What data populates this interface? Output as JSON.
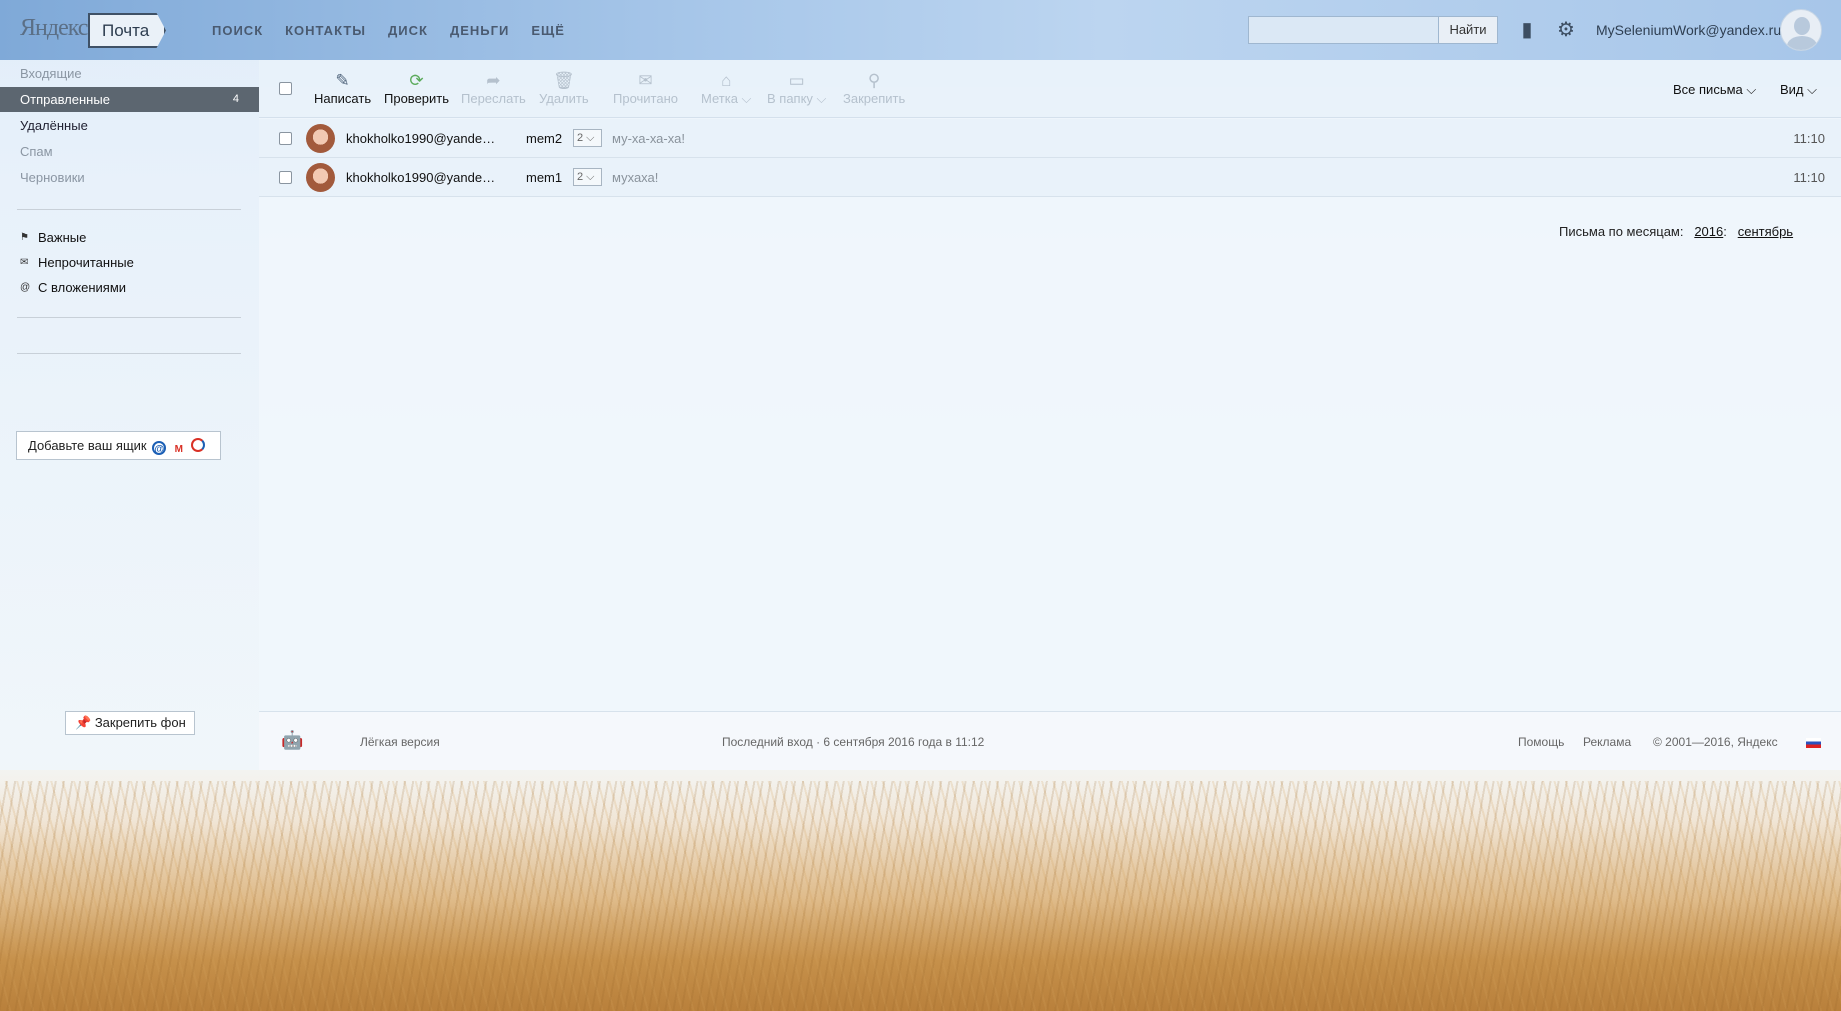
{
  "header": {
    "logo": "Яндекс",
    "service": "Почта",
    "nav": [
      "ПОИСК",
      "КОНТАКТЫ",
      "ДИСК",
      "ДЕНЬГИ",
      "ЕЩЁ"
    ],
    "search_placeholder": "",
    "search_button": "Найти",
    "user_email": "MySeleniumWork@yandex.ru"
  },
  "sidebar": {
    "folders": [
      {
        "label": "Входящие",
        "count": ""
      },
      {
        "label": "Отправленные",
        "count": "4"
      },
      {
        "label": "Удалённые",
        "count": ""
      },
      {
        "label": "Спам",
        "count": ""
      },
      {
        "label": "Черновики",
        "count": ""
      }
    ],
    "labels": [
      "Важные",
      "Непрочитанные",
      "С вложениями"
    ],
    "add_mailbox": "Добавьте ваш ящик",
    "pin_background": "Закрепить фон"
  },
  "toolbar": {
    "compose": "Написать",
    "check": "Проверить",
    "forward": "Переслать",
    "delete": "Удалить",
    "read": "Прочитано",
    "label": "Метка",
    "to_folder": "В папку",
    "pin": "Закрепить",
    "all_letters": "Все письма",
    "view": "Вид"
  },
  "messages": [
    {
      "from": "khokholko1990@yande…",
      "subject": "mem2",
      "thread_count": "2",
      "snippet": "му-ха-ха-ха!",
      "time": "11:10"
    },
    {
      "from": "khokholko1990@yande…",
      "subject": "mem1",
      "thread_count": "2",
      "snippet": "мухаха!",
      "time": "11:10"
    }
  ],
  "months": {
    "label": "Письма по месяцам:",
    "year": "2016",
    "sep": ":",
    "month": "сентябрь"
  },
  "footer": {
    "light_version": "Лёгкая версия",
    "last_login": "Последний вход · 6 сентября 2016 года в 11:12",
    "help": "Помощь",
    "ads": "Реклама",
    "copyright": "© 2001—2016, Яндекс"
  }
}
